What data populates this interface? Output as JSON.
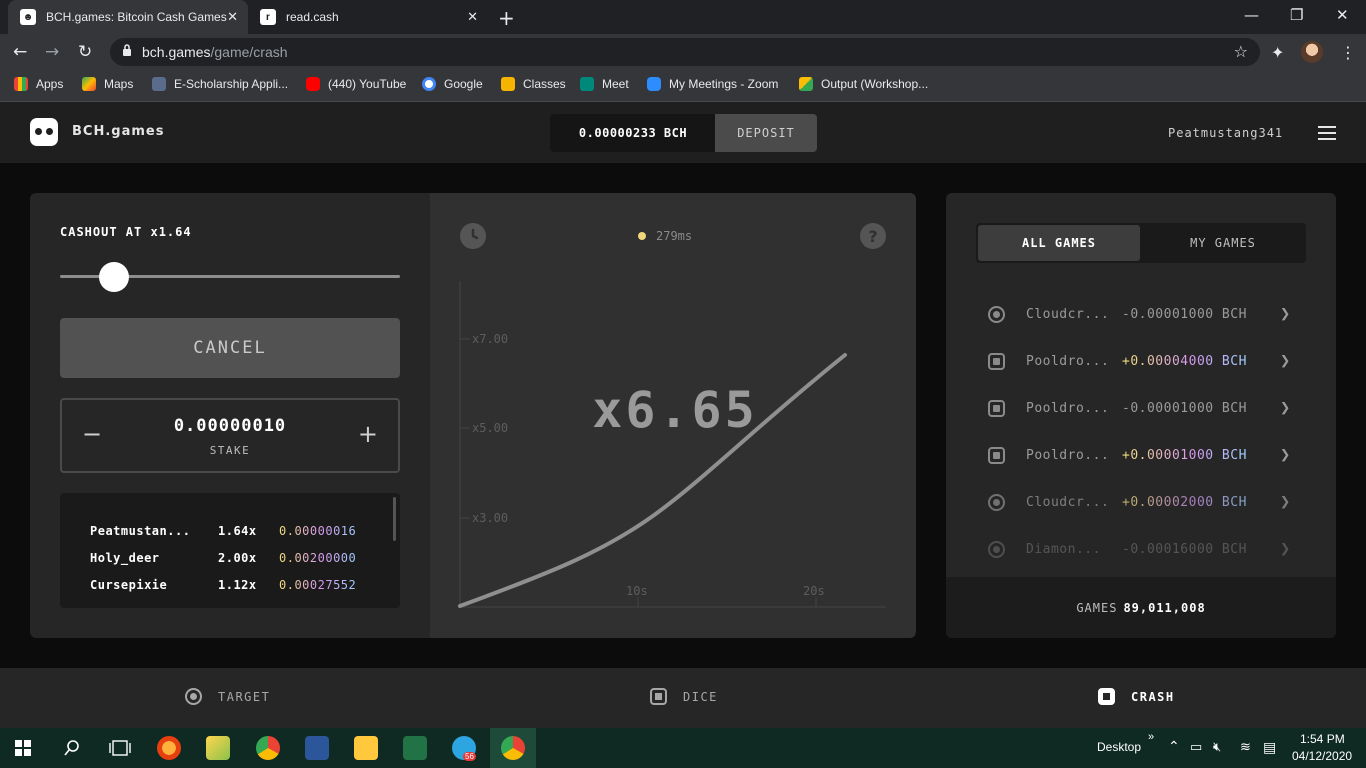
{
  "browser": {
    "tabs": [
      {
        "title": "BCH.games: Bitcoin Cash Games",
        "active": true
      },
      {
        "title": "read.cash",
        "active": false
      }
    ],
    "url_host": "bch.games",
    "url_path": "/game/crash",
    "bookmarks": [
      "Apps",
      "Maps",
      "E-Scholarship Appli...",
      "(440) YouTube",
      "Google",
      "Classes",
      "Meet",
      "My Meetings - Zoom",
      "Output (Workshop..."
    ]
  },
  "header": {
    "brand": "BCH.games",
    "balance": "0.00000233 BCH",
    "deposit_label": "DEPOSIT",
    "username": "Peatmustang341"
  },
  "bet_panel": {
    "cashout_label": "CASHOUT AT x1.64",
    "cashout_slider_fraction": 0.16,
    "cancel_label": "CANCEL",
    "stake_value": "0.00000010",
    "stake_label": "STAKE",
    "minus": "−",
    "plus": "+",
    "bets": [
      {
        "name": "Peatmustan...",
        "mult": "1.64x",
        "amount": "0.00000016"
      },
      {
        "name": "Holy_deer",
        "mult": "2.00x",
        "amount": "0.00200000"
      },
      {
        "name": "Cursepixie",
        "mult": "1.12x",
        "amount": "0.00027552"
      }
    ]
  },
  "crash_chart": {
    "latency": "279ms",
    "help": "?",
    "multiplier": "x6.65",
    "y_ticks": [
      "x7.00",
      "x5.00",
      "x3.00"
    ],
    "x_ticks": [
      "10s",
      "20s"
    ]
  },
  "games_panel": {
    "tab_all": "ALL GAMES",
    "tab_mine": "MY GAMES",
    "rows": [
      {
        "icon": "circle",
        "player": "Cloudcr...",
        "amount": "-0.00001000 BCH",
        "win": false
      },
      {
        "icon": "square",
        "player": "Pooldro...",
        "amount": "+0.00004000 BCH",
        "win": true
      },
      {
        "icon": "square",
        "player": "Pooldro...",
        "amount": "-0.00001000 BCH",
        "win": false
      },
      {
        "icon": "square",
        "player": "Pooldro...",
        "amount": "+0.00001000 BCH",
        "win": true
      },
      {
        "icon": "circle",
        "player": "Cloudcr...",
        "amount": "+0.00002000 BCH",
        "win": true
      },
      {
        "icon": "circle",
        "player": "Diamon...",
        "amount": "-0.00016000 BCH",
        "win": false
      }
    ],
    "games_label": "GAMES",
    "games_count": "89,011,008"
  },
  "game_nav": {
    "target": "TARGET",
    "dice": "DICE",
    "crash": "CRASH"
  },
  "taskbar": {
    "desktop_label": "Desktop",
    "time": "1:54 PM",
    "date": "04/12/2020",
    "telegram_badge": "56"
  }
}
